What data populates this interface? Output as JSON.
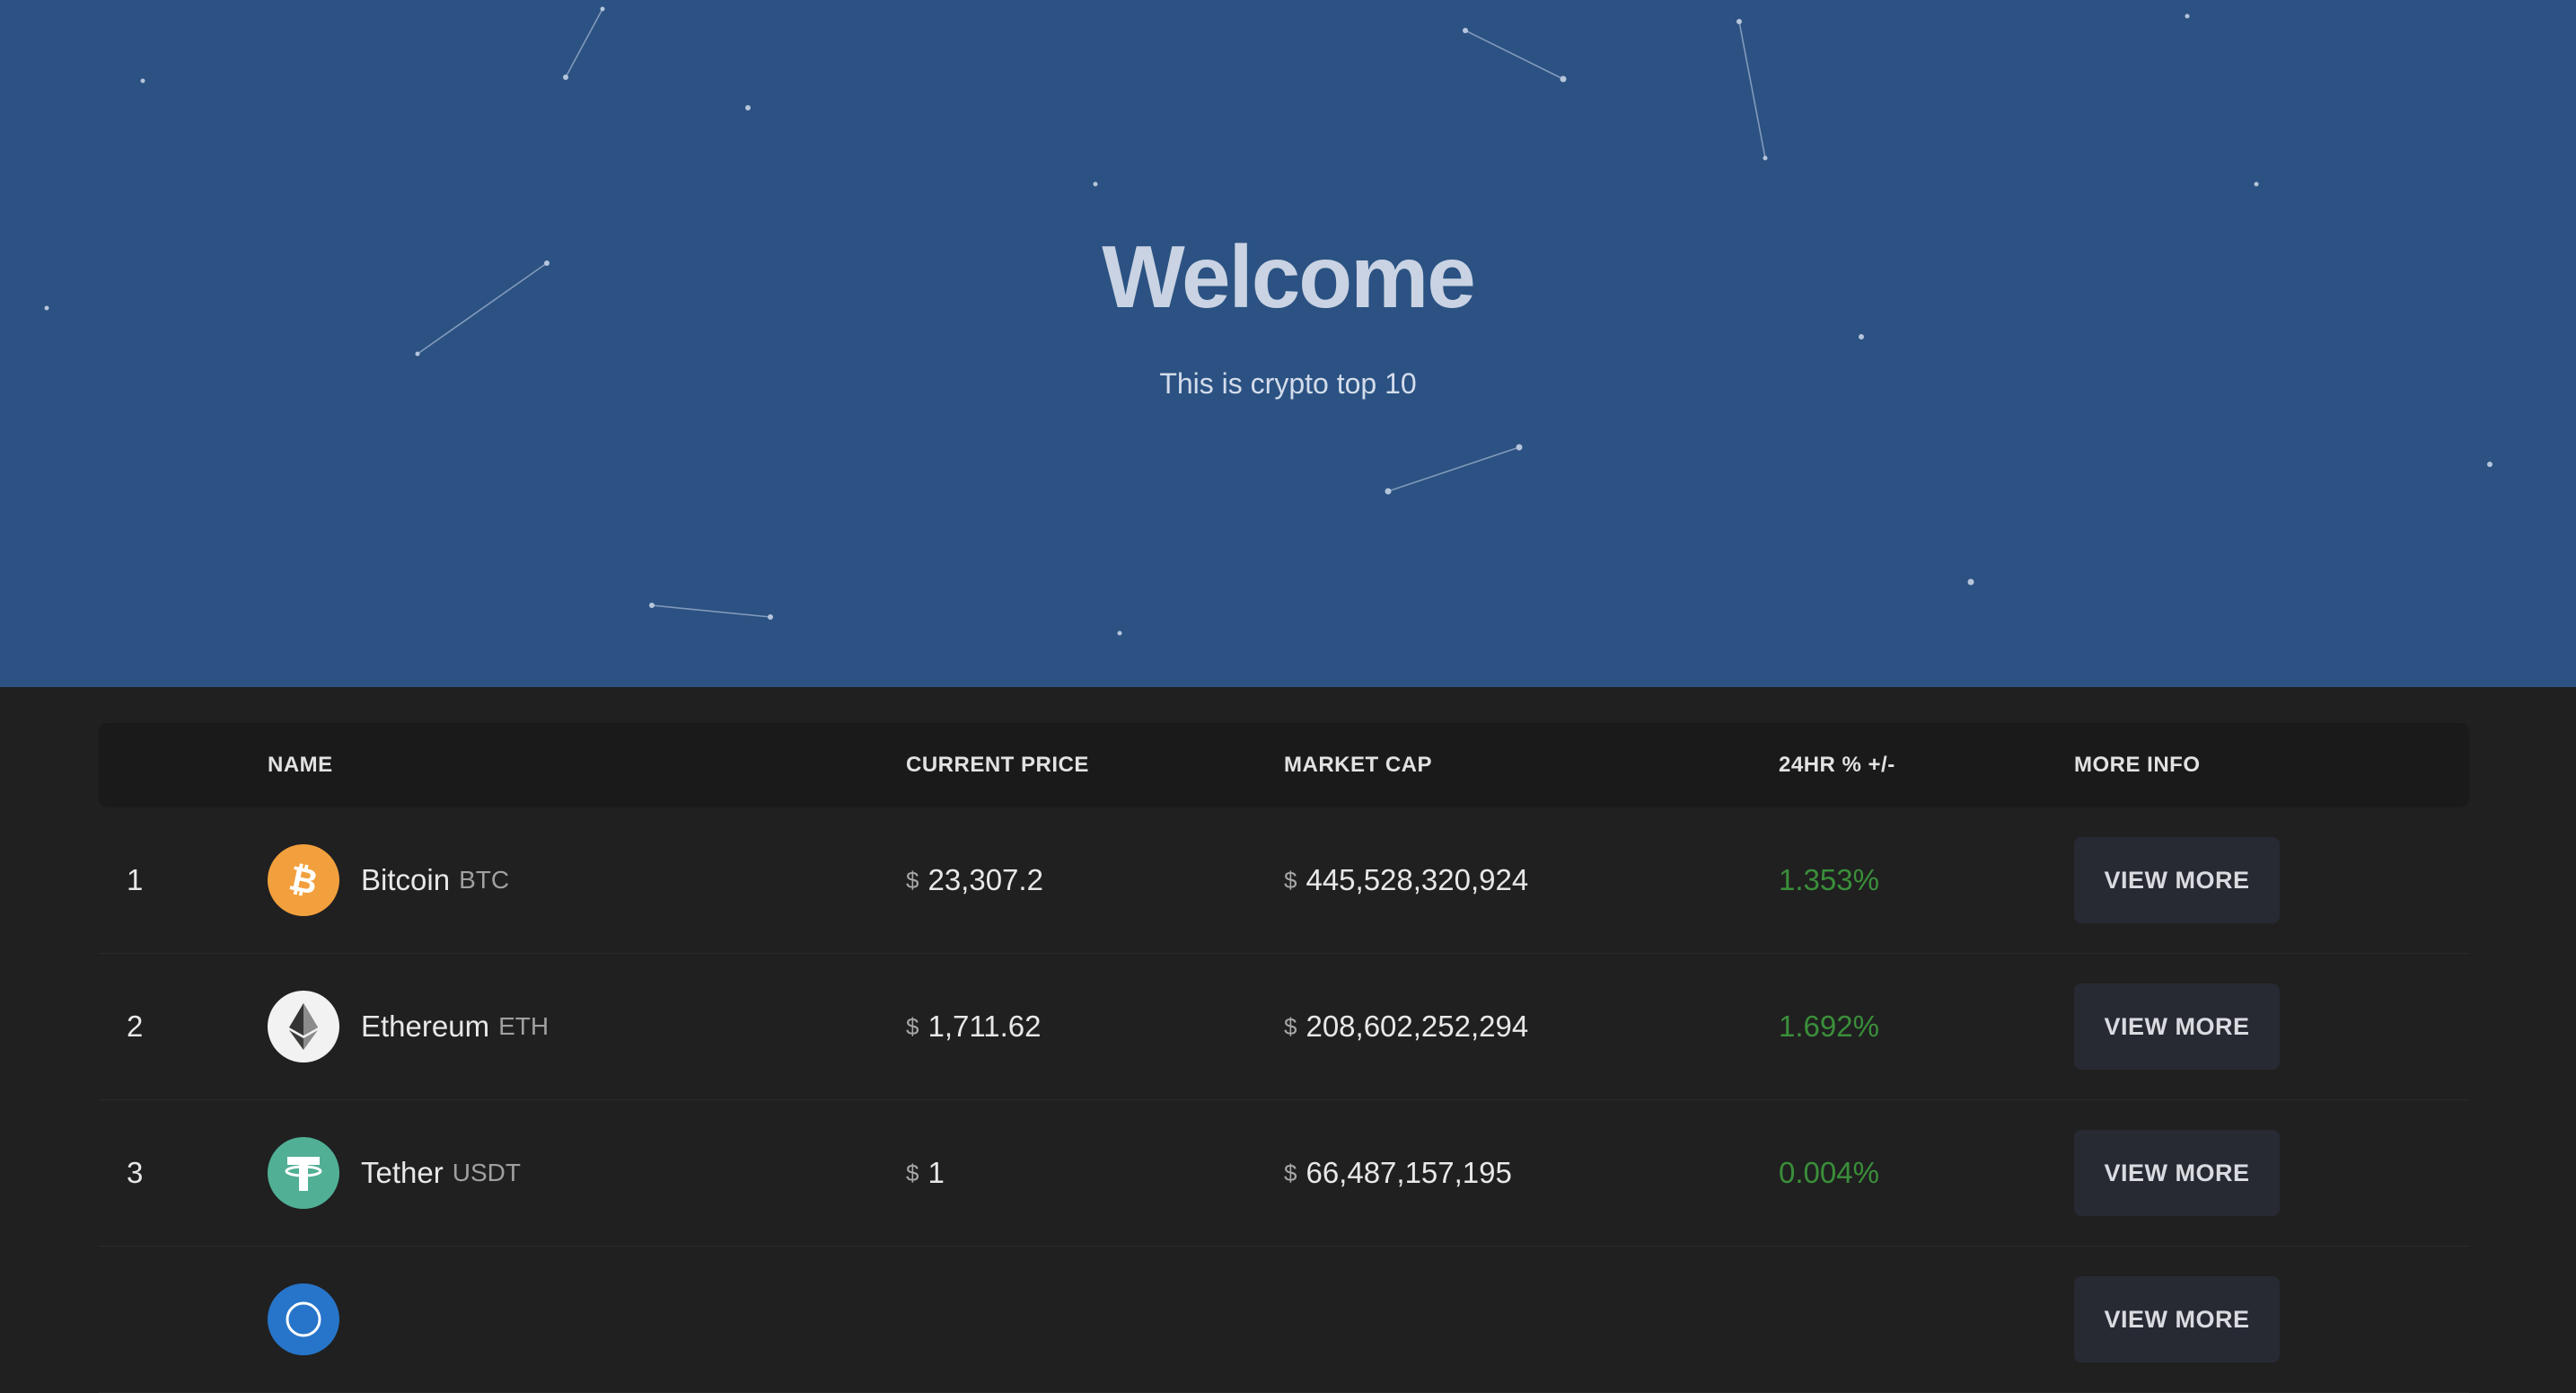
{
  "hero": {
    "title": "Welcome",
    "subtitle": "This is crypto top 10"
  },
  "table": {
    "headers": {
      "rank": "",
      "name": "NAME",
      "price": "CURRENT PRICE",
      "market_cap": "MARKET CAP",
      "change": "24HR % +/-",
      "more": "MORE INFO"
    },
    "currency_symbol": "$",
    "button_label": "VIEW MORE",
    "rows": [
      {
        "rank": "1",
        "name": "Bitcoin",
        "symbol": "BTC",
        "price": "23,307.2",
        "market_cap": "445,528,320,924",
        "change": "1.353%",
        "icon": "bitcoin-icon",
        "icon_color": "#f2a03d"
      },
      {
        "rank": "2",
        "name": "Ethereum",
        "symbol": "ETH",
        "price": "1,711.62",
        "market_cap": "208,602,252,294",
        "change": "1.692%",
        "icon": "ethereum-icon",
        "icon_color": "#f2f2f2"
      },
      {
        "rank": "3",
        "name": "Tether",
        "symbol": "USDT",
        "price": "1",
        "market_cap": "66,487,157,195",
        "change": "0.004%",
        "icon": "tether-icon",
        "icon_color": "#50af95"
      },
      {
        "rank": "",
        "name": "",
        "symbol": "",
        "price": "",
        "market_cap": "",
        "change": "",
        "icon": "usd-coin-icon",
        "icon_color": "#2775ca"
      }
    ]
  },
  "colors": {
    "hero_bg": "#2b5282",
    "page_bg": "#202020",
    "positive_change": "#3a8f3a",
    "button_bg": "#272a33"
  }
}
